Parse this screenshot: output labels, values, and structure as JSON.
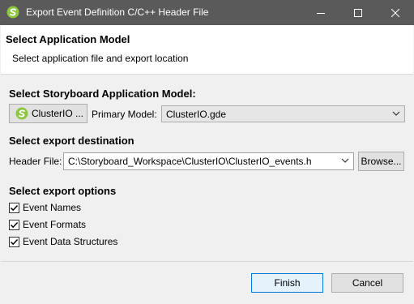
{
  "window": {
    "title": "Export Event Definition C/C++ Header File",
    "app_icon": "storyboard-logo-icon",
    "minimize_icon": "minimize-icon",
    "maximize_icon": "maximize-icon",
    "close_icon": "close-icon",
    "titlebar_color": "#5a5a5a"
  },
  "header": {
    "title": "Select Application Model",
    "description": "Select application file and export location"
  },
  "model_section": {
    "label": "Select Storyboard Application Model:",
    "app_button_label": "ClusterIO ...",
    "app_button_icon": "storyboard-logo-icon",
    "primary_model_label": "Primary Model:",
    "primary_model_value": "ClusterIO.gde"
  },
  "destination_section": {
    "label": "Select export destination",
    "header_file_label": "Header File:",
    "header_file_value": "C:\\Storyboard_Workspace\\ClusterIO\\ClusterIO_events.h",
    "browse_label": "Browse..."
  },
  "options_section": {
    "label": "Select export options",
    "options": [
      {
        "label": "Event Names",
        "checked": true
      },
      {
        "label": "Event Formats",
        "checked": true
      },
      {
        "label": "Event Data Structures",
        "checked": true
      }
    ]
  },
  "footer": {
    "finish_label": "Finish",
    "cancel_label": "Cancel"
  },
  "colors": {
    "accent": "#0078d7",
    "logo_green": "#8dc63f"
  }
}
